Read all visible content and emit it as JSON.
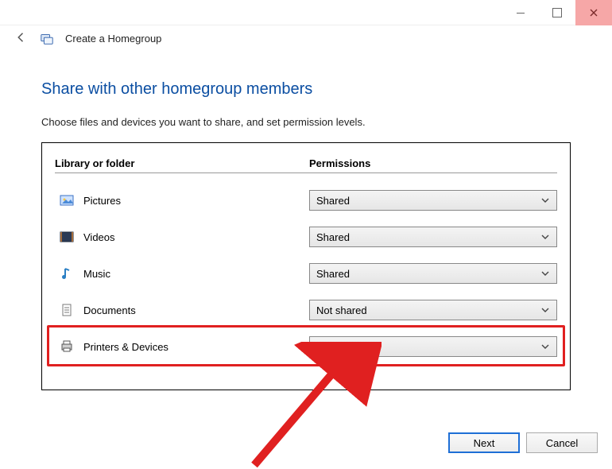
{
  "window": {
    "title": "Create a Homegroup"
  },
  "heading": "Share with other homegroup members",
  "instruction": "Choose files and devices you want to share, and set permission levels.",
  "table": {
    "header_library": "Library or folder",
    "header_permissions": "Permissions",
    "rows": [
      {
        "icon": "pictures-icon",
        "label": "Pictures",
        "permission": "Shared"
      },
      {
        "icon": "videos-icon",
        "label": "Videos",
        "permission": "Shared"
      },
      {
        "icon": "music-icon",
        "label": "Music",
        "permission": "Shared"
      },
      {
        "icon": "documents-icon",
        "label": "Documents",
        "permission": "Not shared"
      },
      {
        "icon": "printers-icon",
        "label": "Printers & Devices",
        "permission": "Shared"
      }
    ]
  },
  "buttons": {
    "next": "Next",
    "cancel": "Cancel"
  },
  "annotation": {
    "highlighted_row_index": 4
  }
}
